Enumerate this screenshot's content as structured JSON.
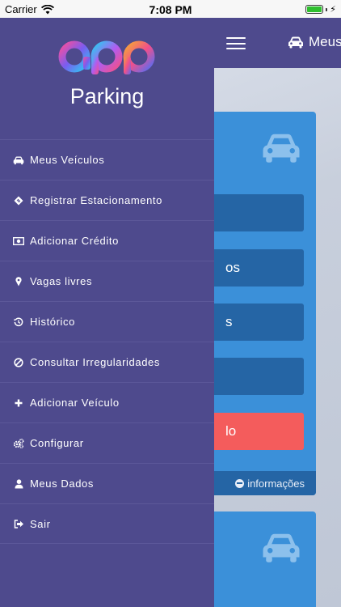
{
  "status_bar": {
    "carrier": "Carrier",
    "time": "7:08 PM"
  },
  "header": {
    "title": "Meus"
  },
  "drawer": {
    "app_name": "Parking",
    "items": [
      {
        "label": "Meus Veículos",
        "icon": "car-icon"
      },
      {
        "label": "Registrar Estacionamento",
        "icon": "ticket-icon"
      },
      {
        "label": "Adicionar Crédito",
        "icon": "money-icon"
      },
      {
        "label": "Vagas livres",
        "icon": "map-marker-icon"
      },
      {
        "label": "Histórico",
        "icon": "history-icon"
      },
      {
        "label": "Consultar Irregularidades",
        "icon": "ban-icon"
      },
      {
        "label": "Adicionar Veículo",
        "icon": "plus-icon"
      },
      {
        "label": "Configurar",
        "icon": "gears-icon"
      },
      {
        "label": "Meus Dados",
        "icon": "user-icon"
      },
      {
        "label": "Sair",
        "icon": "sign-out-icon"
      }
    ]
  },
  "card": {
    "buttons": [
      "",
      "os",
      "s",
      "",
      "lo"
    ],
    "footer": "informações"
  },
  "colors": {
    "drawer": "#4e4a8d",
    "card": "#3b90d9",
    "button": "#2565a5",
    "danger": "#f45c5c"
  }
}
